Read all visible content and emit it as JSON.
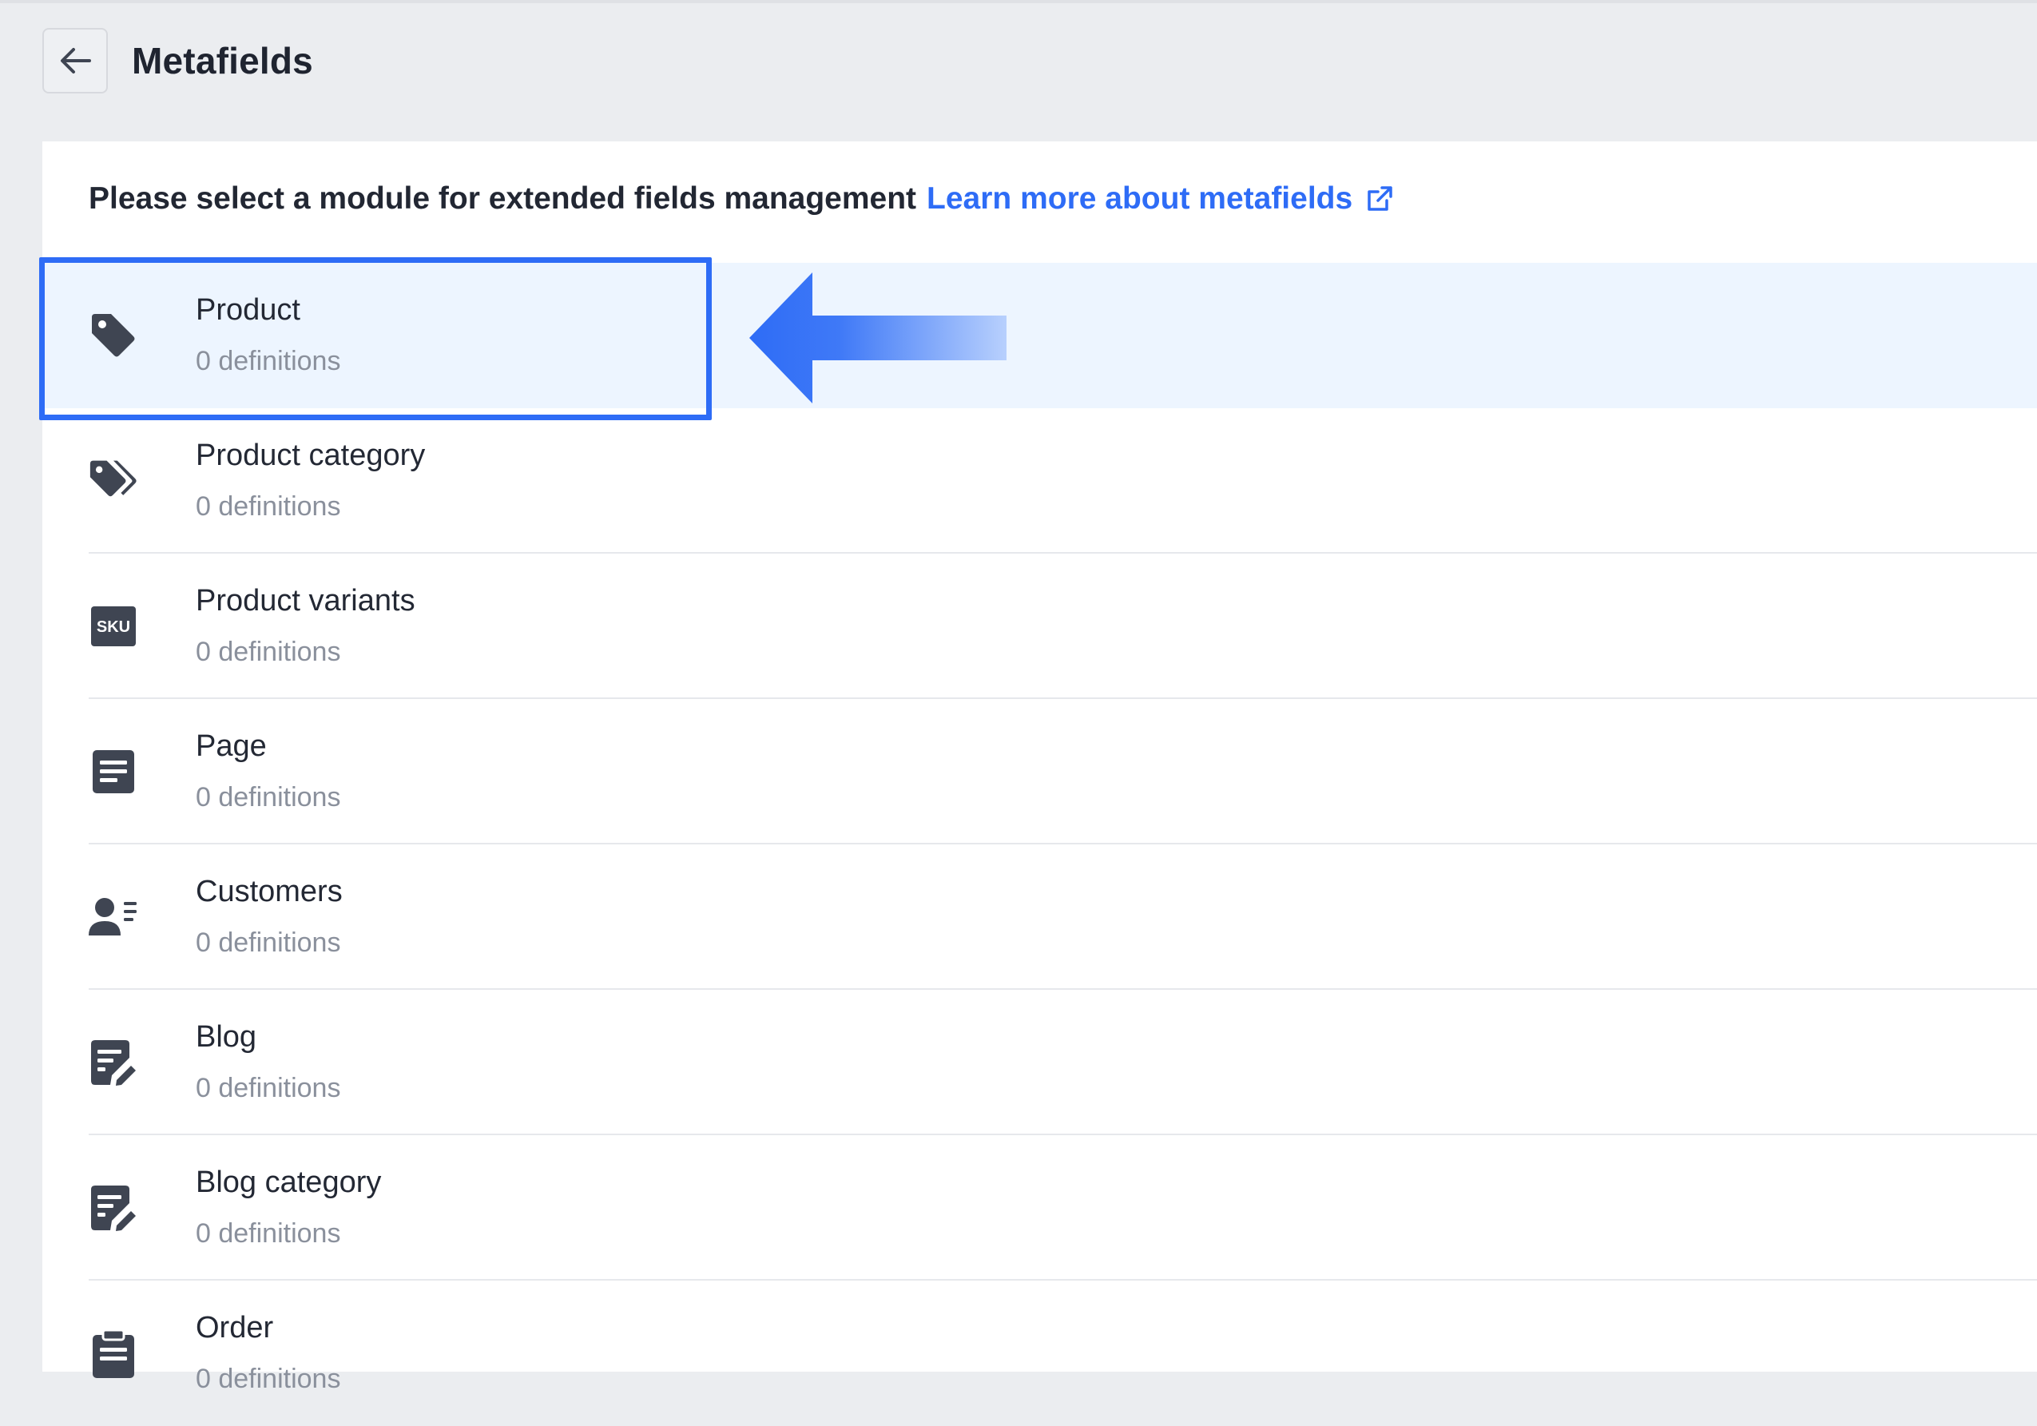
{
  "header": {
    "title": "Metafields",
    "back_icon": "arrow-left-icon"
  },
  "intro": {
    "text": "Please select a module for extended fields management",
    "link_label": "Learn more about metafields",
    "link_icon": "external-link-icon"
  },
  "colors": {
    "accent": "#2e6cf6",
    "active_row": "#edf5ff",
    "icon": "#3f4552"
  },
  "modules": [
    {
      "name": "Product",
      "count": "0 definitions",
      "icon": "tag-icon",
      "selected": true
    },
    {
      "name": "Product category",
      "count": "0 definitions",
      "icon": "tags-icon"
    },
    {
      "name": "Product variants",
      "count": "0 definitions",
      "icon": "sku-icon",
      "icon_text": "SKU"
    },
    {
      "name": "Page",
      "count": "0 definitions",
      "icon": "document-icon"
    },
    {
      "name": "Customers",
      "count": "0 definitions",
      "icon": "customer-card-icon"
    },
    {
      "name": "Blog",
      "count": "0 definitions",
      "icon": "edit-document-icon"
    },
    {
      "name": "Blog category",
      "count": "0 definitions",
      "icon": "edit-document-icon"
    },
    {
      "name": "Order",
      "count": "0 definitions",
      "icon": "clipboard-icon"
    }
  ]
}
